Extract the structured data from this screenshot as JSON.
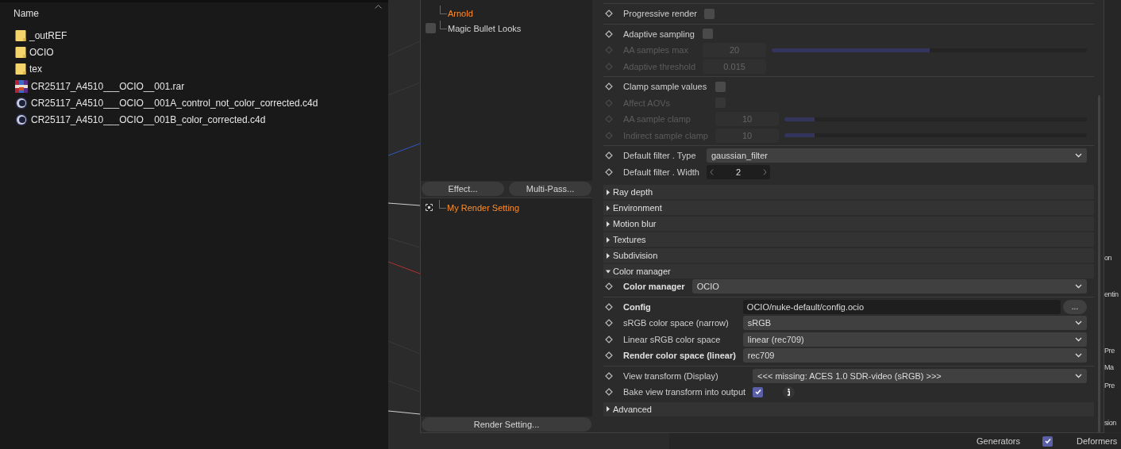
{
  "explorer": {
    "column_header": "Name",
    "items": [
      {
        "name": "_outREF",
        "kind": "folder"
      },
      {
        "name": "OCIO",
        "kind": "folder"
      },
      {
        "name": "tex",
        "kind": "folder"
      },
      {
        "name": "CR25117_A4510___OCIO__001.rar",
        "kind": "archive"
      },
      {
        "name": "CR25117_A4510___OCIO__001A_control_not_color_corrected.c4d",
        "kind": "scene"
      },
      {
        "name": "CR25117_A4510___OCIO__001B_color_corrected.c4d",
        "kind": "scene"
      }
    ]
  },
  "render_settings": {
    "effects": [
      {
        "label": "Arnold",
        "kind": "plain",
        "selected": true
      },
      {
        "label": "Magic Bullet Looks",
        "kind": "checkbox",
        "selected": false,
        "checked": false
      }
    ],
    "effect_buttons": [
      "Effect...",
      "Multi-Pass..."
    ],
    "settings_list": [
      {
        "label": "My Render Setting",
        "selected": true
      }
    ],
    "footer_button": "Render Setting...",
    "top_groups": [
      {
        "rows": [
          {
            "kind": "checkbox",
            "label": "Progressive render",
            "checked": false,
            "disabled": false
          }
        ]
      },
      {
        "rows": [
          {
            "kind": "checkbox",
            "label": "Adaptive sampling",
            "checked": false,
            "disabled": false
          },
          {
            "kind": "slider",
            "label": "AA samples max",
            "value": "20",
            "level": 0.5,
            "disabled": true
          },
          {
            "kind": "number",
            "label": "Adaptive threshold",
            "value": "0.015",
            "disabled": true
          }
        ]
      },
      {
        "rows": [
          {
            "kind": "checkbox",
            "label": "Clamp sample values",
            "checked": false,
            "disabled": false
          },
          {
            "kind": "checkbox",
            "label": "Affect AOVs",
            "checked": false,
            "disabled": true
          },
          {
            "kind": "slider",
            "label": "AA sample clamp",
            "value": "10",
            "level": 0.1,
            "disabled": true
          },
          {
            "kind": "slider",
            "label": "Indirect sample clamp",
            "value": "10",
            "level": 0.1,
            "disabled": true
          }
        ]
      },
      {
        "rows": [
          {
            "kind": "dropdown",
            "label": "Default filter . Type",
            "value": "gaussian_filter",
            "disabled": false
          },
          {
            "kind": "stepper",
            "label": "Default filter . Width",
            "value": "2",
            "disabled": false
          }
        ]
      }
    ],
    "sections": [
      {
        "label": "Ray depth",
        "expanded": false
      },
      {
        "label": "Environment",
        "expanded": false
      },
      {
        "label": "Motion blur",
        "expanded": false
      },
      {
        "label": "Textures",
        "expanded": false
      },
      {
        "label": "Subdivision",
        "expanded": false
      },
      {
        "label": "Color manager",
        "expanded": true,
        "groups": [
          {
            "rows": [
              {
                "kind": "dropdown",
                "label": "Color manager",
                "value": "OCIO",
                "bold": true,
                "disabled": false
              }
            ]
          },
          {
            "rows": [
              {
                "kind": "path",
                "label": "Config",
                "value": "OCIO/nuke-default/config.ocio",
                "button": "...",
                "bold": true,
                "disabled": false
              },
              {
                "kind": "dropdown",
                "label": "sRGB color space (narrow)",
                "value": "sRGB",
                "bold": false,
                "disabled": false
              },
              {
                "kind": "dropdown",
                "label": "Linear sRGB color space",
                "value": "linear (rec709)",
                "bold": false,
                "disabled": false
              },
              {
                "kind": "dropdown",
                "label": "Render color space (linear)",
                "value": "rec709",
                "bold": true,
                "disabled": false
              }
            ]
          },
          {
            "rows": [
              {
                "kind": "dropdown",
                "label": "View transform (Display)",
                "value": "<<< missing: ACES 1.0 SDR-video (sRGB) >>>",
                "bold": false,
                "disabled": false
              },
              {
                "kind": "checkbox",
                "label": "Bake view transform into output",
                "checked": true,
                "info": true,
                "bold": false,
                "disabled": false
              }
            ]
          }
        ]
      },
      {
        "label": "Advanced",
        "expanded": false
      }
    ]
  },
  "side_panel": {
    "fragments": [
      "on",
      "entin",
      "Pre",
      "Ma",
      "Pre",
      "sion"
    ]
  },
  "bottom_bar": {
    "items": [
      {
        "label": "Generators",
        "checked": true
      },
      {
        "label": "Deformers"
      }
    ]
  }
}
